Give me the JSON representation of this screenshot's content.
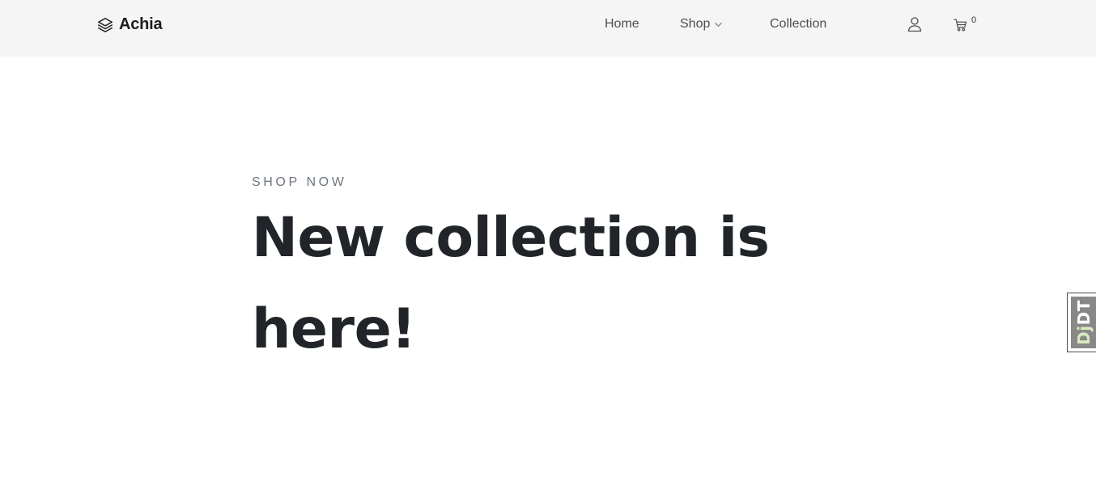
{
  "header": {
    "brand": {
      "name": "Achia",
      "icon": "layers-icon"
    },
    "nav": [
      {
        "label": "Home"
      },
      {
        "label": "Shop",
        "icon": "chevron-down-icon"
      },
      {
        "label": "Collection"
      }
    ],
    "actions": {
      "user_icon": "user-icon",
      "cart_icon": "cart-icon",
      "cart_count": "0"
    }
  },
  "hero": {
    "eyebrow": "SHOP NOW",
    "title": "New collection is here!"
  },
  "debug_toolbar": {
    "label_prefix": "Dj",
    "label_suffix": "DT"
  },
  "colors": {
    "header_bg": "#f5f5f5",
    "text_dark": "#212529",
    "text_muted": "#6c757d",
    "nav_text": "#4a4f55",
    "debug_bg": "#888888",
    "debug_accent": "#d8ecc0"
  }
}
